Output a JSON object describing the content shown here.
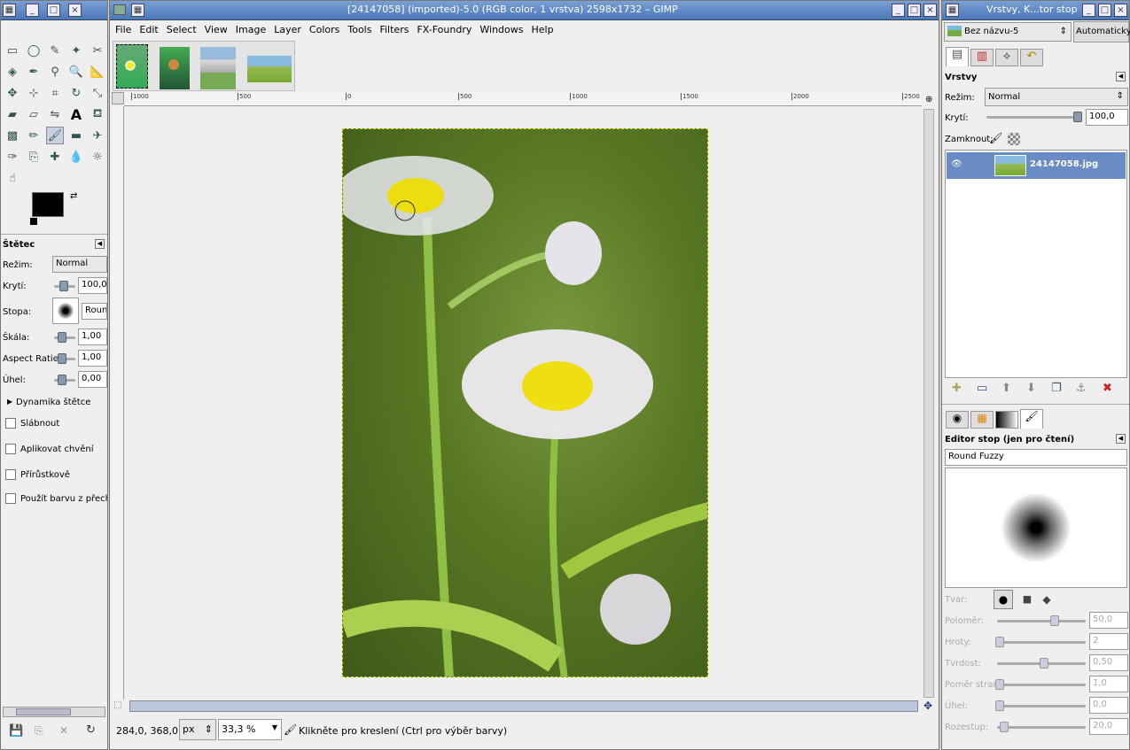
{
  "toolbox": {
    "title": "",
    "tool_icons": [
      "rect-select",
      "ellipse-select",
      "free-select",
      "fuzzy-select",
      "scissors",
      "by-color",
      "paths",
      "color-picker",
      "zoom",
      "measure",
      "move",
      "align",
      "crop",
      "rotate",
      "scale",
      "shear",
      "perspective",
      "flip",
      "text",
      "bucket",
      "blend",
      "pencil",
      "paintbrush",
      "eraser",
      "airbrush",
      "ink",
      "clone",
      "heal",
      "blur",
      "dodge",
      "smudge"
    ],
    "options_title": "Štětec",
    "mode_label": "Režim:",
    "mode_value": "Normal",
    "opacity_label": "Krytí:",
    "opacity_value": "100,0",
    "brush_label": "Stopa:",
    "brush_value": "Round",
    "scale_label": "Škála:",
    "scale_value": "1,00",
    "aspect_label": "Aspect Ratio:",
    "aspect_value": "1,00",
    "angle_label": "Úhel:",
    "angle_value": "0,00",
    "dynamics_label": "Dynamika štětce",
    "checks": [
      "Slábnout",
      "Aplikovat chvění",
      "Přírůstkově",
      "Použít barvu z přechodu"
    ]
  },
  "image_window": {
    "title": "[24147058] (imported)-5.0 (RGB color, 1 vrstva) 2598x1732 – GIMP",
    "menu": [
      "File",
      "Edit",
      "Select",
      "View",
      "Image",
      "Layer",
      "Colors",
      "Tools",
      "Filters",
      "FX-Foundry",
      "Windows",
      "Help"
    ],
    "ruler_labels": [
      "1000",
      "500",
      "0",
      "500",
      "1000",
      "1500",
      "2000",
      "2500"
    ],
    "status_coords": "284,0, 368,0",
    "unit": "px",
    "zoom": "33,3 %",
    "status_message": "Klikněte pro kreslení (Ctrl pro výběr barvy)"
  },
  "layers_window": {
    "title": "Vrstvy, K...tor stop",
    "image_select": "Bez názvu-5",
    "auto_button": "Automaticky",
    "panel_title": "Vrstvy",
    "mode_label": "Režim:",
    "mode_value": "Normal",
    "opacity_label": "Krytí:",
    "opacity_value": "100,0",
    "lock_label": "Zamknout:",
    "layer_name": "24147058.jpg"
  },
  "brush_editor": {
    "title": "Editor stop (jen pro čtení)",
    "brush_name": "Round Fuzzy",
    "shape_label": "Tvar:",
    "params": [
      {
        "label": "Poloměr:",
        "value": "50,0",
        "pos": 0.62
      },
      {
        "label": "Hroty:",
        "value": "2",
        "pos": 0.0
      },
      {
        "label": "Tvrdost:",
        "value": "0,50",
        "pos": 0.5
      },
      {
        "label": "Poměr stran:",
        "value": "1,0",
        "pos": 0.0
      },
      {
        "label": "Úhel:",
        "value": "0,0",
        "pos": 0.0
      },
      {
        "label": "Rozestup:",
        "value": "20,0",
        "pos": 0.05
      }
    ]
  },
  "colors": {
    "title_bar": "#4a78b8",
    "selection": "#6a8cc4",
    "foreground": "#000000",
    "background": "#ffffff"
  }
}
